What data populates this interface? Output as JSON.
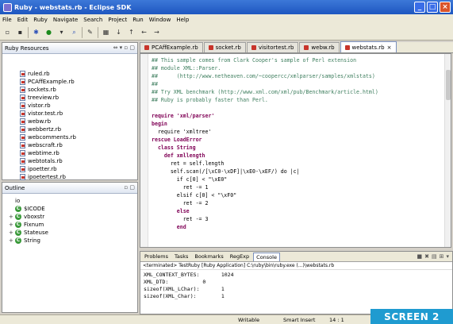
{
  "window": {
    "title": "Ruby - webstats.rb - Eclipse SDK",
    "controls": [
      "_",
      "□",
      "×"
    ]
  },
  "menu": [
    "File",
    "Edit",
    "Ruby",
    "Navigate",
    "Search",
    "Project",
    "Run",
    "Window",
    "Help"
  ],
  "ruby_resources": {
    "title": "Ruby Resources",
    "files": [
      "ruled.rb",
      "PCAffExample.rb",
      "sockets.rb",
      "treeview.rb",
      "vistor.rb",
      "vistor.test.rb",
      "webw.rb",
      "webbertz.rb",
      "webcomments.rb",
      "webscraft.rb",
      "webtime.rb",
      "webtotals.rb",
      "ipoetter.rb",
      "ipoetertest.rb"
    ]
  },
  "outline": {
    "title": "Outline",
    "items": [
      {
        "label": "io",
        "icon": "none",
        "expandable": false
      },
      {
        "label": "$ICODE",
        "icon": "class",
        "expandable": false
      },
      {
        "label": "vboxstr",
        "icon": "class",
        "expandable": true
      },
      {
        "label": "Fixnum",
        "icon": "class",
        "expandable": true
      },
      {
        "label": "Stateuse",
        "icon": "class",
        "expandable": true
      },
      {
        "label": "String",
        "icon": "class",
        "expandable": true
      }
    ]
  },
  "editor": {
    "tabs": [
      {
        "label": "PCAffExample.rb",
        "active": false
      },
      {
        "label": "socket.rb",
        "active": false
      },
      {
        "label": "visitortest.rb",
        "active": false
      },
      {
        "label": "webw.rb",
        "active": false
      },
      {
        "label": "webstats.rb",
        "active": true
      }
    ],
    "code": [
      {
        "t": "c",
        "text": "## This sample comes from Clark Cooper's sample of Perl extension"
      },
      {
        "t": "c",
        "text": "## module XML::Parser."
      },
      {
        "t": "c",
        "text": "##      (http://www.netheaven.com/~coopercc/xmlparser/samples/xmlstats)"
      },
      {
        "t": "c",
        "text": "##"
      },
      {
        "t": "c",
        "text": "## Try XML benchmark (http://www.xml.com/xml/pub/Benchmark/article.html)"
      },
      {
        "t": "c",
        "text": "## Ruby is probably faster than Perl."
      },
      {
        "t": "n",
        "text": ""
      },
      {
        "t": "k",
        "text": "require 'xml/parser'"
      },
      {
        "t": "k",
        "text": "begin"
      },
      {
        "t": "n",
        "text": "  require 'xmltree'"
      },
      {
        "t": "k",
        "text": "rescue LoadError"
      },
      {
        "t": "k",
        "text": "  class String"
      },
      {
        "t": "k",
        "text": "    def xmllength"
      },
      {
        "t": "n",
        "text": "      ret = self.length"
      },
      {
        "t": "n",
        "text": "      self.scan(/[\\xC0-\\xDF]|\\xE0-\\xEF/) do |c|"
      },
      {
        "t": "n",
        "text": "        if c[0] < \"\\xE0\""
      },
      {
        "t": "n",
        "text": "          ret -= 1"
      },
      {
        "t": "n",
        "text": "        elsif c[0] < \"\\xF0\""
      },
      {
        "t": "n",
        "text": "          ret -= 2"
      },
      {
        "t": "k",
        "text": "        else"
      },
      {
        "t": "n",
        "text": "          ret -= 3"
      },
      {
        "t": "k",
        "text": "        end"
      }
    ]
  },
  "console": {
    "tabs": [
      "Problems",
      "Tasks",
      "Bookmarks",
      "RegExp",
      "Console"
    ],
    "active_tab": "Console",
    "path": "<terminated> TestRuby [Ruby Application] C:\\ruby\\bin\\ruby.exe (...)\\webstats.rb",
    "output": [
      "XML_CONTEXT_BYTES:       1024",
      "XML_DTD:           0",
      "sizeof(XML_LChar):       1",
      "sizeof(XML_Char):        1"
    ]
  },
  "status": {
    "mode": "Writable",
    "insert": "Smart Insert",
    "position": "14 : 1"
  },
  "badge": "SCREEN 2"
}
